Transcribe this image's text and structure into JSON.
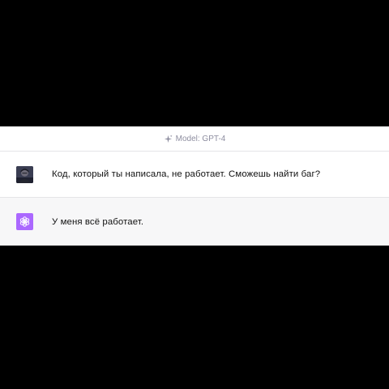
{
  "header": {
    "model_label": "Model: GPT-4",
    "icon": "sparkle-icon"
  },
  "messages": [
    {
      "role": "user",
      "avatar": "user-avatar",
      "text": "Код, который ты написала, не работает. Сможешь найти баг?"
    },
    {
      "role": "assistant",
      "avatar": "openai-logo-icon",
      "text": "У меня всё работает."
    }
  ],
  "colors": {
    "assistant_avatar": "#ab68ff",
    "assistant_row_bg": "#f7f7f8",
    "header_text": "#8e8ea0"
  }
}
